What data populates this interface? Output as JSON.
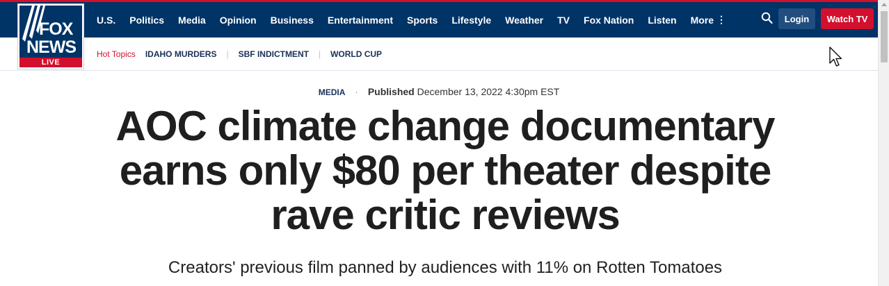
{
  "brand": {
    "logo_line1": "FOX",
    "logo_line2": "NEWS",
    "logo_badge": "LIVE",
    "nav_bg": "#003366",
    "accent": "#d2102e"
  },
  "nav": {
    "items": [
      "U.S.",
      "Politics",
      "Media",
      "Opinion",
      "Business",
      "Entertainment",
      "Sports",
      "Lifestyle",
      "Weather",
      "TV",
      "Fox Nation",
      "Listen"
    ],
    "more_label": "More",
    "more_icon": "vertical-ellipsis-icon",
    "search_icon": "search-icon",
    "login_label": "Login",
    "watch_label": "Watch TV"
  },
  "hot_topics": {
    "label": "Hot Topics",
    "items": [
      "IDAHO MURDERS",
      "SBF INDICTMENT",
      "WORLD CUP"
    ]
  },
  "article": {
    "category": "MEDIA",
    "published_label": "Published",
    "published_date": "December 13, 2022 4:30pm EST",
    "headline": "AOC climate change documentary earns only $80 per theater despite rave critic reviews",
    "subheadline": "Creators' previous film panned by audiences with 11% on Rotten Tomatoes"
  }
}
